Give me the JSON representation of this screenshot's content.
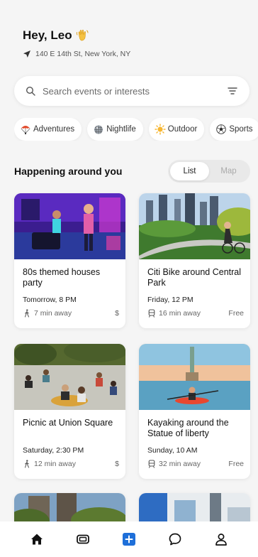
{
  "header": {
    "greeting": "Hey, Leo",
    "greeting_emoji_icon": "waving-hand-icon",
    "location": "140 E 14th St, New York, NY"
  },
  "search": {
    "placeholder": "Search events or interests"
  },
  "categories": [
    {
      "label": "Adventures",
      "icon": "parachute-icon"
    },
    {
      "label": "Nightlife",
      "icon": "disco-ball-icon"
    },
    {
      "label": "Outdoor",
      "icon": "sun-icon"
    },
    {
      "label": "Sports",
      "icon": "soccer-ball-icon"
    }
  ],
  "section": {
    "title": "Happening around you",
    "view_list": "List",
    "view_map": "Map",
    "active_view": "List"
  },
  "events": [
    {
      "title": "80s themed houses party",
      "when": "Tomorrow, 8 PM",
      "distance": "7 min away",
      "travel_icon": "walking-icon",
      "price": "$"
    },
    {
      "title": "Citi Bike around Central Park",
      "when": "Friday, 12 PM",
      "distance": "16 min away",
      "travel_icon": "train-icon",
      "price": "Free"
    },
    {
      "title": "Picnic at Union Square",
      "when": "Saturday, 2:30 PM",
      "distance": "12 min away",
      "travel_icon": "walking-icon",
      "price": "$"
    },
    {
      "title": "Kayaking around the Statue of liberty",
      "when": "Sunday, 10 AM",
      "distance": "32 min away",
      "travel_icon": "train-icon",
      "price": "Free"
    }
  ],
  "nav": [
    "home-icon",
    "tickets-icon",
    "add-icon",
    "chat-icon",
    "profile-icon"
  ],
  "colors": {
    "accent": "#1e6fd9",
    "background": "#f5f5f5"
  }
}
